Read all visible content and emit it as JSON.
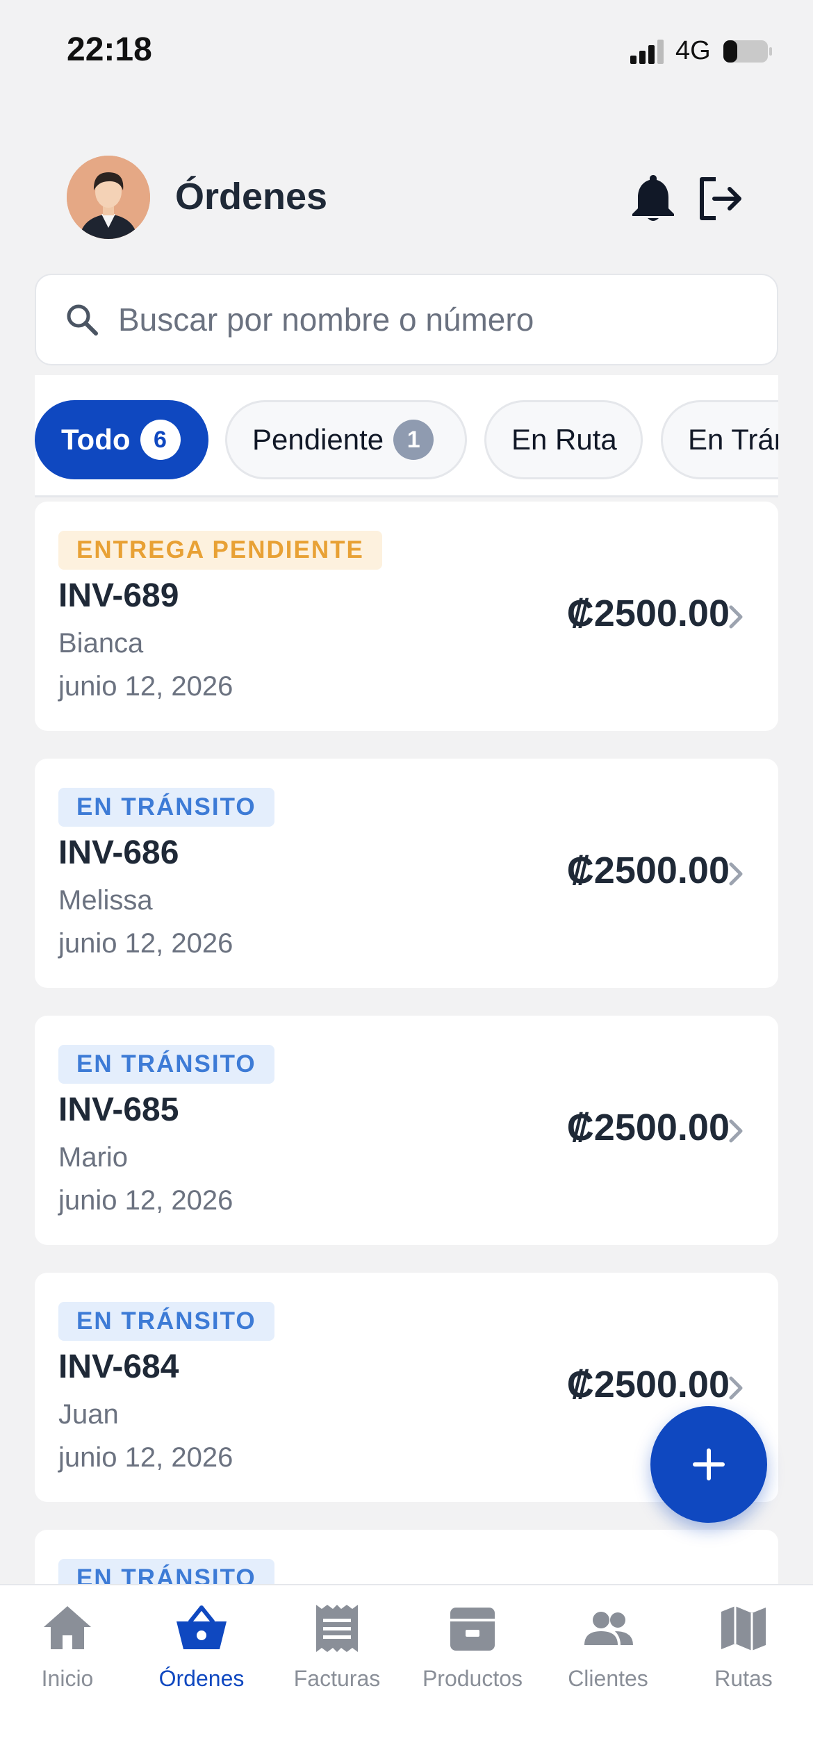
{
  "status_bar": {
    "time": "22:18",
    "network": "4G"
  },
  "header": {
    "title": "Órdenes"
  },
  "search": {
    "placeholder": "Buscar por nombre o número"
  },
  "filters": [
    {
      "label": "Todo",
      "count": "6",
      "active": true
    },
    {
      "label": "Pendiente",
      "count": "1",
      "active": false
    },
    {
      "label": "En Ruta",
      "count": null,
      "active": false
    },
    {
      "label": "En Tránsito",
      "count": null,
      "active": false
    }
  ],
  "orders": [
    {
      "status": "ENTREGA PENDIENTE",
      "status_type": "pending",
      "number": "INV-689",
      "client": "Bianca",
      "date": "junio 12, 2026",
      "amount": "₡2500.00"
    },
    {
      "status": "EN TRÁNSITO",
      "status_type": "transit",
      "number": "INV-686",
      "client": "Melissa",
      "date": "junio 12, 2026",
      "amount": "₡2500.00"
    },
    {
      "status": "EN TRÁNSITO",
      "status_type": "transit",
      "number": "INV-685",
      "client": "Mario",
      "date": "junio 12, 2026",
      "amount": "₡2500.00"
    },
    {
      "status": "EN TRÁNSITO",
      "status_type": "transit",
      "number": "INV-684",
      "client": "Juan",
      "date": "junio 12, 2026",
      "amount": "₡2500.00"
    },
    {
      "status": "EN TRÁNSITO",
      "status_type": "transit",
      "number": "",
      "client": "",
      "date": "",
      "amount": ""
    }
  ],
  "nav": [
    {
      "label": "Inicio",
      "icon": "home-icon",
      "active": false
    },
    {
      "label": "Órdenes",
      "icon": "basket-icon",
      "active": true
    },
    {
      "label": "Facturas",
      "icon": "receipt-icon",
      "active": false
    },
    {
      "label": "Productos",
      "icon": "box-icon",
      "active": false
    },
    {
      "label": "Clientes",
      "icon": "people-icon",
      "active": false
    },
    {
      "label": "Rutas",
      "icon": "map-icon",
      "active": false
    }
  ],
  "colors": {
    "primary": "#0f48c0",
    "pending_text": "#e8a135",
    "transit_text": "#3d7bd6",
    "background": "#f2f2f3"
  }
}
